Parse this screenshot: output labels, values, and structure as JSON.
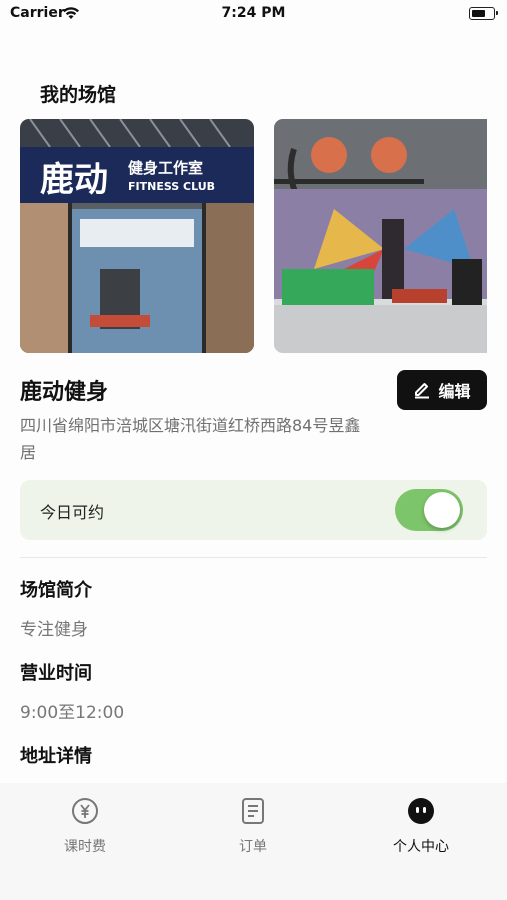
{
  "status_bar": {
    "carrier": "Carrier",
    "time": "7:24 PM"
  },
  "venue_section": {
    "title": "我的场馆"
  },
  "gallery": {
    "photo1_sign_text": "鹿动",
    "photo1_sign_sub": "健身工作室",
    "photo1_sign_en": "FITNESS CLUB"
  },
  "venue": {
    "name": "鹿动健身",
    "edit_label": "编辑",
    "address": "四川省绵阳市涪城区塘汛街道红桥西路84号昱鑫居"
  },
  "availability": {
    "label": "今日可约",
    "enabled": true
  },
  "info": {
    "intro_title": "场馆简介",
    "intro_value": "专注健身",
    "hours_title": "营业时间",
    "hours_value": "9:00至12:00",
    "address_title": "地址详情"
  },
  "tabbar": {
    "tabs": [
      {
        "label": "课时费",
        "icon": "coin-icon",
        "active": false
      },
      {
        "label": "订单",
        "icon": "document-icon",
        "active": false
      },
      {
        "label": "个人中心",
        "icon": "profile-icon",
        "active": true
      }
    ]
  },
  "colors": {
    "accent_green": "#7dc56a",
    "card_bg": "#eef4ea",
    "button_dark": "#111111"
  }
}
